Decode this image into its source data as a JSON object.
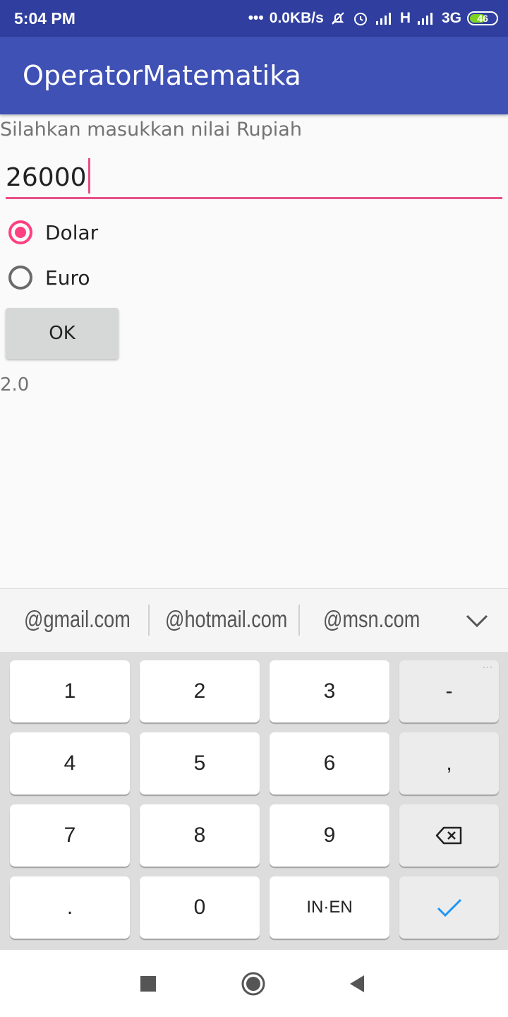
{
  "status_bar": {
    "time": "5:04 PM",
    "dots": "•••",
    "speed": "0.0KB/s",
    "net1": "H",
    "net2": "3G",
    "battery": "46"
  },
  "app_bar": {
    "title": "OperatorMatematika"
  },
  "form": {
    "prompt": "Silahkan masukkan nilai Rupiah",
    "amount_value": "26000",
    "options": [
      {
        "label": "Dolar",
        "selected": true
      },
      {
        "label": "Euro",
        "selected": false
      }
    ],
    "ok_label": "OK",
    "result": "2.0"
  },
  "suggestions": [
    "@gmail.com",
    "@hotmail.com",
    "@msn.com"
  ],
  "keyboard": {
    "rows": [
      [
        "1",
        "2",
        "3",
        "-"
      ],
      [
        "4",
        "5",
        "6",
        ","
      ],
      [
        "7",
        "8",
        "9",
        "backspace"
      ],
      [
        ".",
        "0",
        "IN·EN",
        "done"
      ]
    ],
    "accent_color": "#2196f3"
  },
  "colors": {
    "primary": "#3f51b5",
    "primary_dark": "#303f9f",
    "accent": "#ff4081"
  }
}
